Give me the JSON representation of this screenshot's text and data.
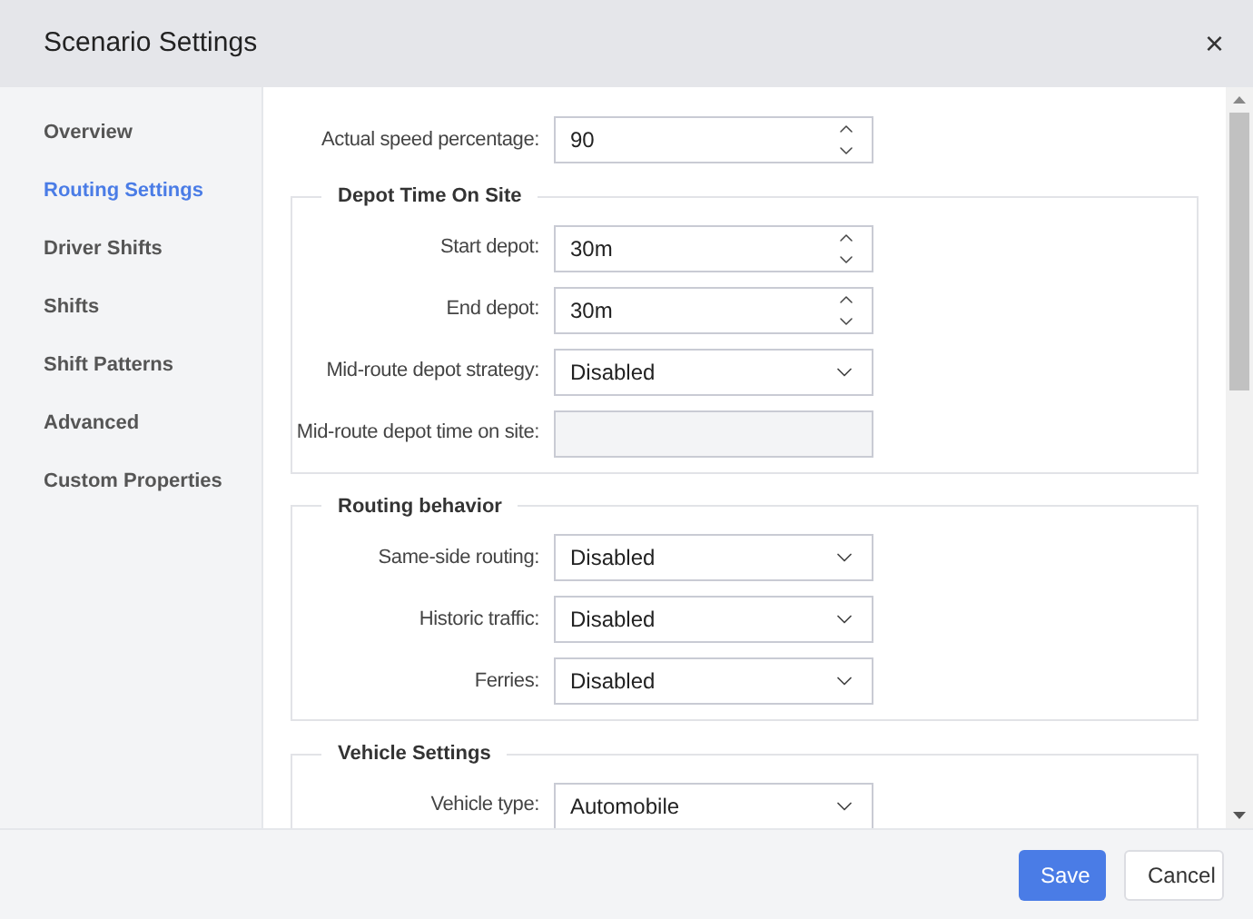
{
  "window": {
    "title": "Scenario Settings",
    "close": "×"
  },
  "sidebar": {
    "items": [
      {
        "label": "Overview",
        "selected": false
      },
      {
        "label": "Routing Settings",
        "selected": true
      },
      {
        "label": "Driver Shifts",
        "selected": false
      },
      {
        "label": "Shifts",
        "selected": false
      },
      {
        "label": "Shift Patterns",
        "selected": false
      },
      {
        "label": "Advanced",
        "selected": false
      },
      {
        "label": "Custom Properties",
        "selected": false
      }
    ]
  },
  "top_fields": [
    {
      "kind": "number",
      "label": "Actual speed percentage:",
      "value": "90"
    }
  ],
  "groups": [
    {
      "title": "Depot Time On Site",
      "fields": [
        {
          "kind": "number",
          "label": "Start depot:",
          "value": "30m"
        },
        {
          "kind": "number",
          "label": "End depot:",
          "value": "30m"
        },
        {
          "kind": "select",
          "label": "Mid-route depot strategy:",
          "value": "Disabled"
        },
        {
          "kind": "disabled",
          "label": "Mid-route depot time on site:"
        }
      ]
    },
    {
      "title": "Routing behavior",
      "fields": [
        {
          "kind": "select",
          "label": "Same-side routing:",
          "value": "Disabled"
        },
        {
          "kind": "select",
          "label": "Historic traffic:",
          "value": "Disabled"
        },
        {
          "kind": "select",
          "label": "Ferries:",
          "value": "Disabled"
        }
      ]
    },
    {
      "title": "Vehicle Settings",
      "fields": [
        {
          "kind": "select",
          "label": "Vehicle type:",
          "value": "Automobile"
        }
      ]
    }
  ],
  "footer": {
    "buttons": [
      {
        "label": "Save",
        "kind": "primary"
      },
      {
        "label": "Cancel",
        "kind": "secondary"
      }
    ]
  }
}
